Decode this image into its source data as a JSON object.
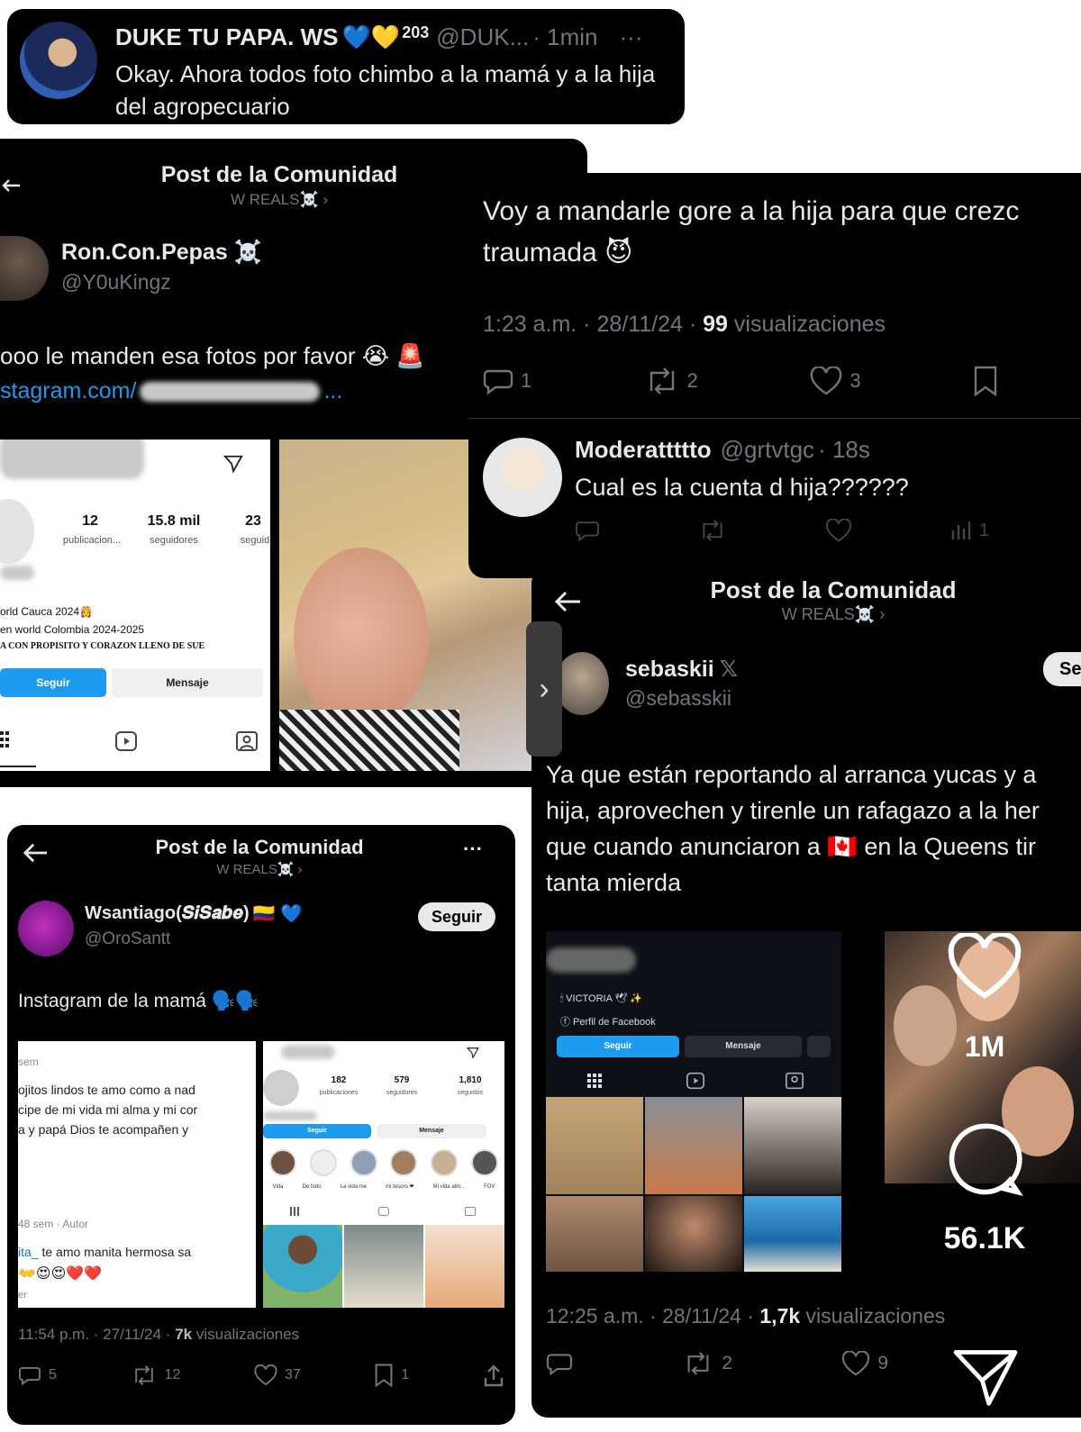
{
  "top_tweet": {
    "name": "DUKE TU PAPA. WS",
    "badge": "💙💛",
    "count": "203",
    "handle": "@DUK...",
    "time": "· 1min",
    "more": "···",
    "text": "Okay. Ahora todos foto chimbo a la mamá y a la hija del agropecuario"
  },
  "post1": {
    "header_title": "Post de la Comunidad",
    "header_sub": "W REALS☠️ ›",
    "name": "Ron.Con.Pepas ☠️",
    "handle": "@Y0uKingz",
    "text": "ooo le manden esa fotos por favor 😭 🚨",
    "link": "stagram.com/",
    "link_tail": "...",
    "ig_profile": {
      "posts_n": "12",
      "posts_l": "publicacion...",
      "followers_n": "15.8 mil",
      "followers_l": "seguidores",
      "following_n": "23",
      "following_l": "seguid",
      "bio1": "orld Cauca 2024👸",
      "bio2": "en world Colombia 2024-2025",
      "bio3": "A CON PROPISITO Y CORAZON LLENO DE SUE",
      "follow": "Seguir",
      "message": "Mensaje"
    }
  },
  "tweet_right": {
    "text": "Voy a mandarle gore a la hija para que crezc traumada 😈",
    "meta_time": "1:23 a.m. · 28/11/24 · ",
    "meta_views_n": "99",
    "meta_views_l": " visualizaciones",
    "replies": "1",
    "retweets": "2",
    "likes": "3"
  },
  "reply": {
    "name": "Moderattttto",
    "handle": "@grtvtgc",
    "time": "· 18s",
    "text": "Cual es la cuenta d hija??????",
    "views": "1"
  },
  "post2": {
    "header_title": "Post de la Comunidad",
    "header_sub": "W REALS☠️ ›",
    "name": "sebaskii",
    "handle": "@sebasskii",
    "follow": "Se",
    "text": "Ya que están reportando al arranca yucas y a hija, aprovechen y tirenle un rafagazo a la her que cuando anunciaron a 🇨🇦 en la Queens tir tanta mierda",
    "ig_label": "🕯 VICTORIA 🕊 ✨",
    "ig_fb": "ⓕ Perfil de Facebook",
    "ig_follow": "Seguir",
    "ig_message": "Mensaje",
    "meta_time": "12:25 a.m. · 28/11/24 · ",
    "meta_views_n": "1,7k",
    "meta_views_l": " visualizaciones",
    "retweets": "2",
    "likes": "9"
  },
  "post3": {
    "header_title": "Post de la Comunidad",
    "header_sub": "W REALS☠️ ›",
    "more": "···",
    "name": "Wsantiago(𝑺𝒊𝑺𝒂𝒃𝒆)",
    "name_emoji": "🇨🇴 💙",
    "handle": "@OroSantt",
    "follow": "Seguir",
    "text": "Instagram de la mamá 🗣️🗣️",
    "left_img": {
      "top": "sem",
      "l1": "ojitos lindos te amo como a nad",
      "l2": "cipe de mi vida mi alma y mi cor",
      "l3": "a y papá Dios te acompañen y",
      "foot": "48 sem · Autor",
      "comment_user": "ita_",
      "comment": " te amo manita hermosa sa",
      "emojis": "👐😍😍❤️❤️",
      "er": "er"
    },
    "right_img": {
      "posts_n": "182",
      "followers_n": "579",
      "following_n": "1,810",
      "posts_l": "publicaciones",
      "followers_l": "seguidores",
      "following_l": "seguidos",
      "follow": "Seguir",
      "message": "Mensaje",
      "highlights": [
        "Vida",
        "De todo",
        "La vida me",
        "mi tesoro ❤",
        "Mi vida alm...",
        "FOV"
      ]
    },
    "meta_time": "11:54 p.m. · 27/11/24 · ",
    "meta_views_n": "7k",
    "meta_views_l": " visualizaciones",
    "replies": "5",
    "retweets": "12",
    "likes": "37",
    "bookmarks": "1"
  },
  "reel_overlay": {
    "likes": "1M",
    "comments": "56.1K"
  },
  "colors": {
    "x_bg": "#000000",
    "x_muted": "#71767b",
    "x_link": "#1d9bf0",
    "ig_blue": "#1d9bf0"
  }
}
